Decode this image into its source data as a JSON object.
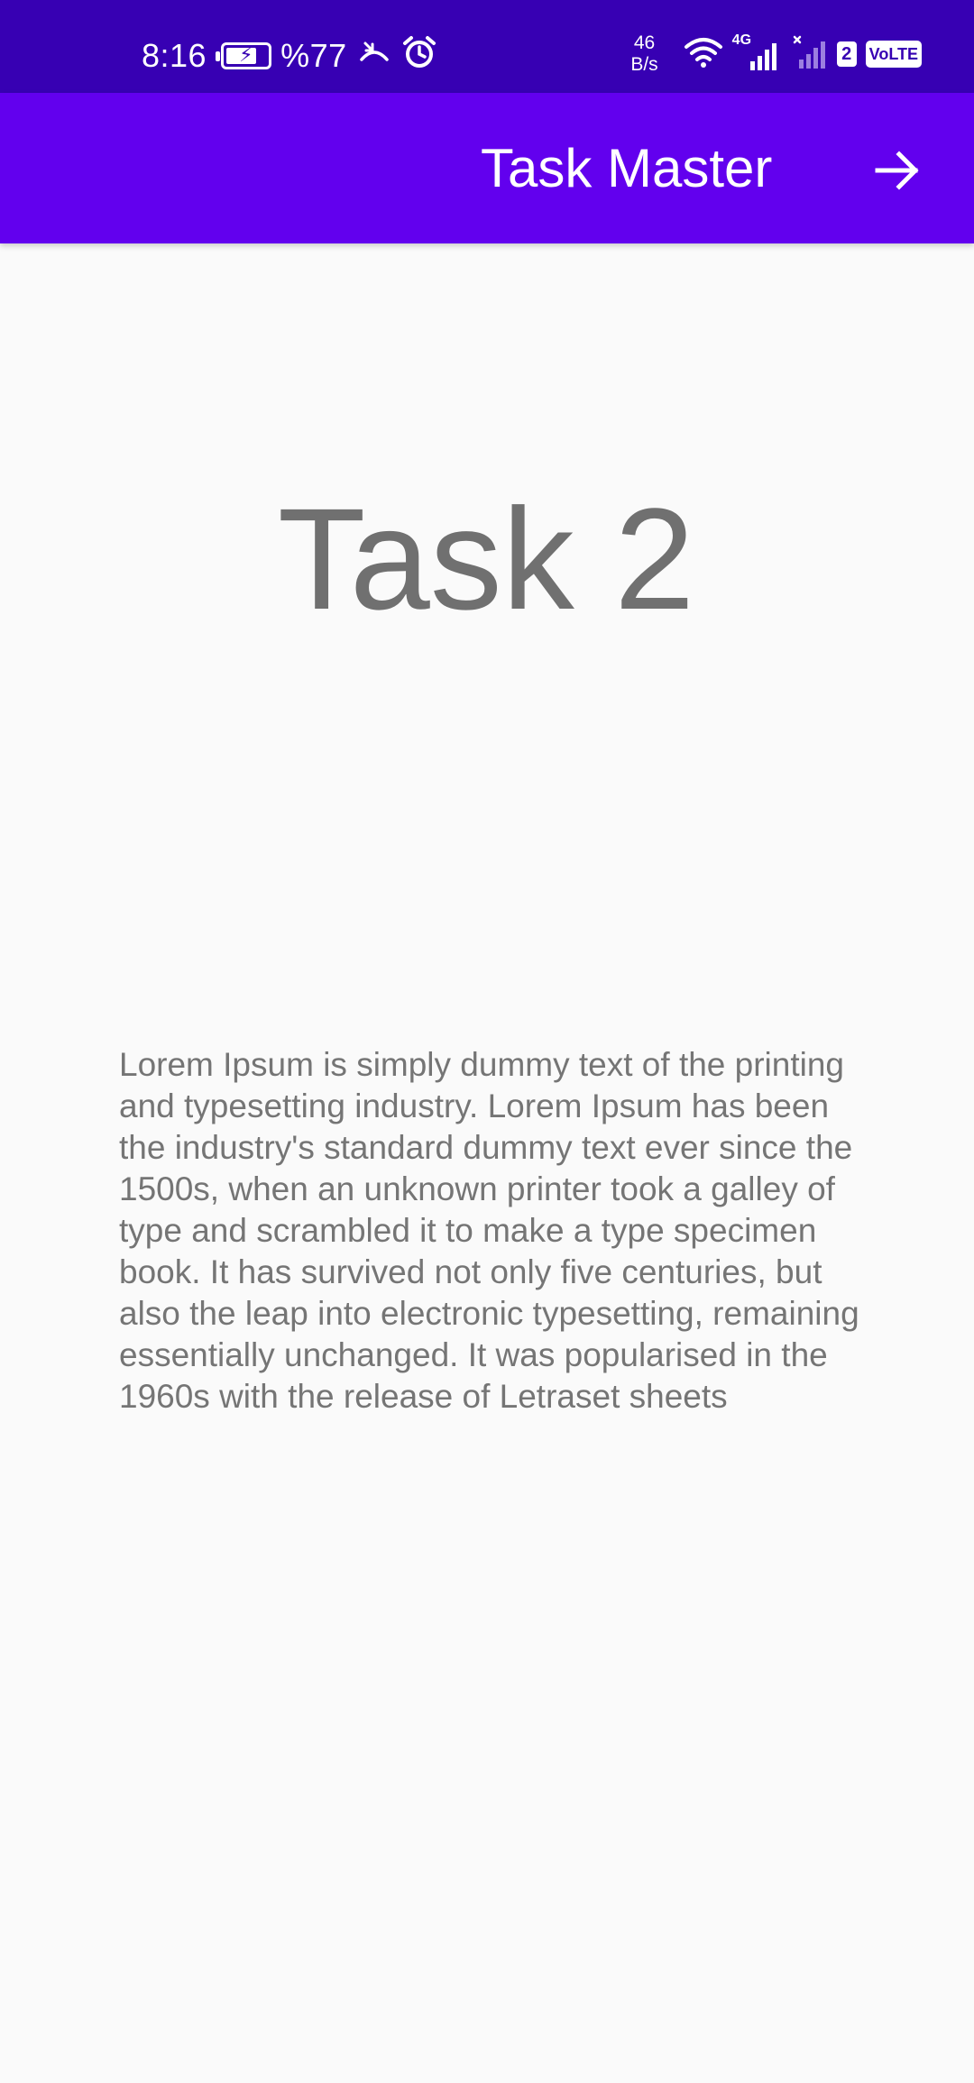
{
  "status_bar": {
    "time": "8:16",
    "battery_text": "%77",
    "battery_level": 0.77,
    "net_speed_value": "46",
    "net_speed_unit": "B/s",
    "network_type": "4G",
    "sim_slot": "2",
    "volte": "VoLTE"
  },
  "app_bar": {
    "title": "Task Master",
    "forward_icon": "arrow-forward-icon"
  },
  "task": {
    "title": "Task 2",
    "body": "Lorem Ipsum is simply dummy text of the printing and typesetting industry. Lorem Ipsum has been the industry's standard dummy text ever since the 1500s, when an unknown printer took a galley of type and scrambled it to make a type specimen book. It has survived not only five centuries, but also the leap into electronic typesetting, remaining essentially unchanged. It was popularised in the 1960s with the release of Letraset sheets"
  },
  "colors": {
    "status_bar": "#3700B3",
    "app_bar": "#6200EE",
    "background": "#FAFAFA",
    "title_text": "#707070",
    "body_text": "#757575"
  }
}
